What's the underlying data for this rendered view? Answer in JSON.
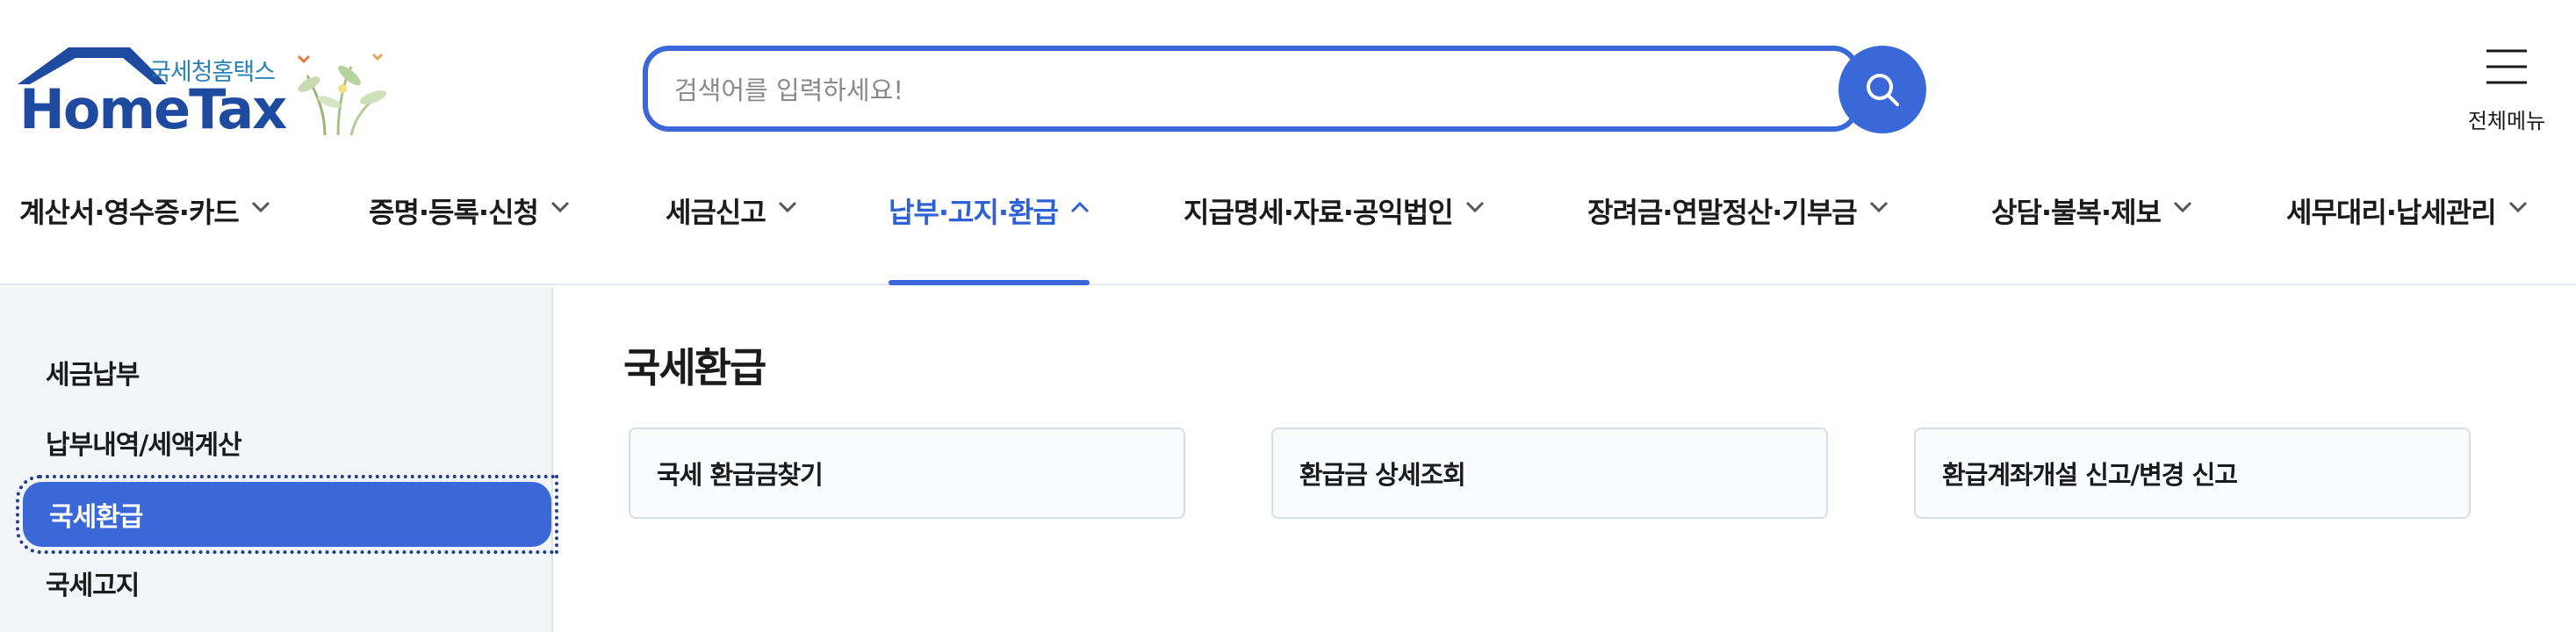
{
  "header": {
    "logo": {
      "org_name": "국세청홈택스",
      "brand_name": "HomeTax"
    },
    "search": {
      "placeholder": "검색어를 입력하세요!",
      "value": ""
    },
    "all_menu_label": "전체메뉴"
  },
  "gnb": {
    "items": [
      {
        "label": "계산서·영수증·카드"
      },
      {
        "label": "증명·등록·신청"
      },
      {
        "label": "세금신고"
      },
      {
        "label": "납부·고지·환급",
        "active": true
      },
      {
        "label": "지급명세·자료·공익법인"
      },
      {
        "label": "장려금·연말정산·기부금"
      },
      {
        "label": "상담·불복·제보"
      },
      {
        "label": "세무대리·납세관리"
      }
    ]
  },
  "sidebar": {
    "items": [
      {
        "label": "세금납부"
      },
      {
        "label": "납부내역/세액계산"
      },
      {
        "label": "국세환급",
        "active": true
      },
      {
        "label": "국세고지"
      }
    ]
  },
  "main": {
    "title": "국세환급",
    "cards": [
      {
        "label": "국세 환급금찾기"
      },
      {
        "label": "환급금 상세조회"
      },
      {
        "label": "환급계좌개설 신고/변경 신고"
      }
    ]
  },
  "colors": {
    "accent": "#3a68d8",
    "brand": "#1e4aa0",
    "sidebar_bg": "#f3f5f9"
  },
  "icons": {
    "search": "search-icon",
    "menu": "hamburger-menu-icon",
    "chevron": "chevron-down-icon"
  }
}
